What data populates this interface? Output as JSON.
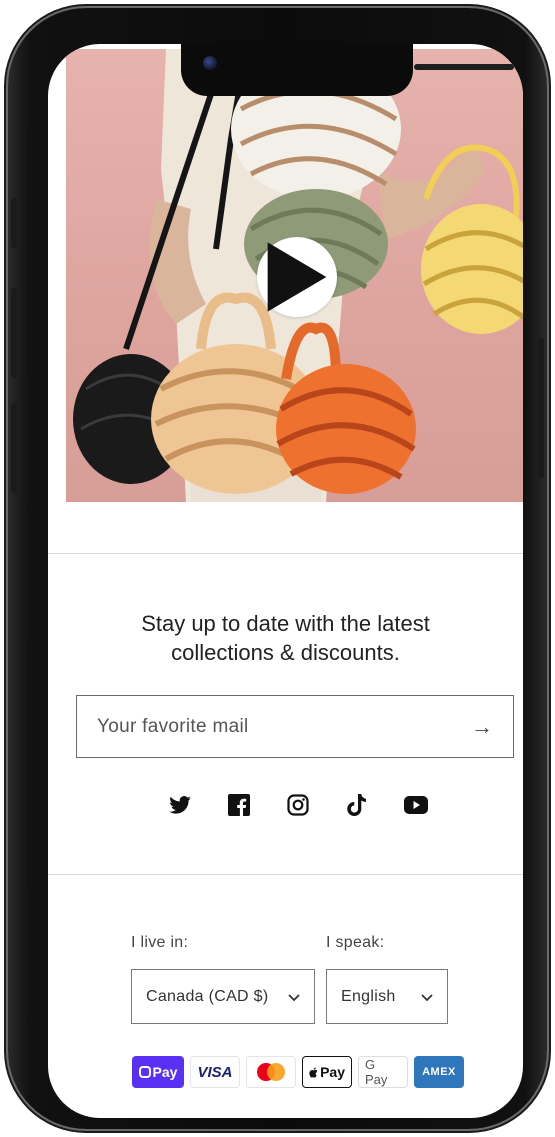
{
  "newsletter": {
    "text": "Stay up to date with the latest\ncollections & discounts.",
    "placeholder": "Your favorite mail",
    "submit_icon": "arrow-right-icon"
  },
  "social": [
    "twitter-icon",
    "facebook-icon",
    "instagram-icon",
    "tiktok-icon",
    "youtube-icon"
  ],
  "locale": {
    "country_label": "I live in:",
    "country_value": "Canada (CAD $)",
    "language_label": "I speak:",
    "language_value": "English"
  },
  "payments": {
    "shop_pay": "Pay",
    "visa": "VISA",
    "apple_pay": "Pay",
    "google_pay": "G Pay",
    "amex": "AMEX"
  },
  "colors": {
    "background_pink": "#dea59f",
    "shop_pay": "#5a31f4",
    "visa": "#1a1f71",
    "amex": "#2e77bc"
  }
}
